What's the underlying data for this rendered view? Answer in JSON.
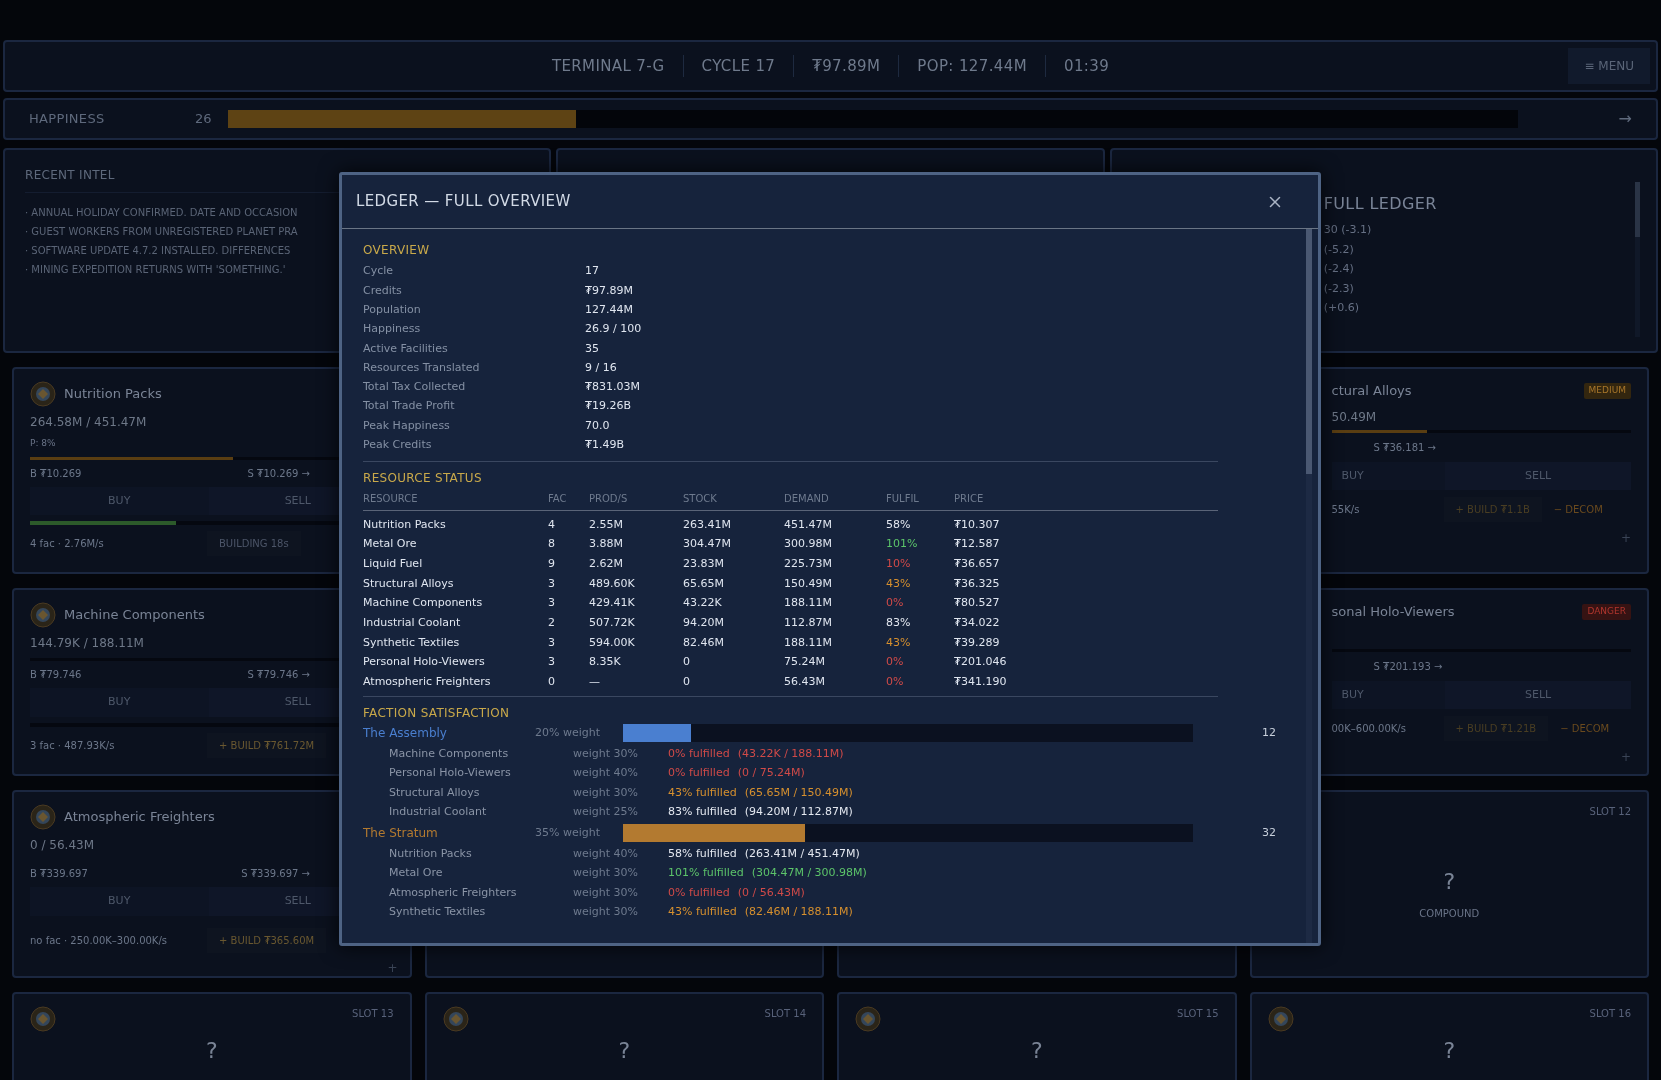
{
  "top_bar": {
    "items": [
      "TERMINAL 7-G",
      "CYCLE 17",
      "₮97.89M",
      "POP: 127.44M",
      "01:39"
    ],
    "menu_button": "≡ MENU"
  },
  "happiness": {
    "label": "HAPPINESS",
    "value": "26",
    "level": 0.27,
    "arrow": "→"
  },
  "intel": {
    "title": "RECENT INTEL",
    "items": [
      "· ANNUAL HOLIDAY CONFIRMED. DATE AND OCCASION",
      "· GUEST WORKERS FROM UNREGISTERED PLANET PRA",
      "· SOFTWARE UPDATE 4.7.2 INSTALLED. DIFFERENCES",
      "· MINING EXPEDITION RETURNS WITH 'SOMETHING.'"
    ]
  },
  "ledger_panel": {
    "button": "FULL LEDGER",
    "lines": [
      "30 (-3.1)",
      "(-5.2)",
      "(-2.4)",
      "(-2.3)",
      "(+0.6)"
    ]
  },
  "left_cards": [
    {
      "name": "Nutrition Packs",
      "stock": "264.58M / 451.47M",
      "note": "P: 8%",
      "stock_bar": {
        "level": 0.57
      },
      "buy_price": "B ₮10.269",
      "sell_price": "S ₮10.269 →",
      "buy": "BUY",
      "sell": "SELL",
      "production_bar": {
        "level": 0.41
      },
      "output": "4 fac · 2.76M/s",
      "action": {
        "label": "BUILDING 18s",
        "kind": "building"
      }
    },
    {
      "name": "Machine Components",
      "stock": "144.79K / 188.11M",
      "buy_price": "B ₮79.746",
      "sell_price": "S ₮79.746 →",
      "buy": "BUY",
      "sell": "SELL",
      "output": "3 fac · 487.93K/s",
      "action": {
        "label": "+ BUILD ₮761.72M",
        "kind": "build"
      }
    },
    {
      "name": "Atmospheric Freighters",
      "stock": "0 / 56.43M",
      "buy_price": "B ₮339.697",
      "sell_price": "S ₮339.697 →",
      "buy": "BUY",
      "sell": "SELL",
      "output": "no fac · 250.00K–300.00K/s",
      "action": {
        "label": "+ BUILD ₮365.60M",
        "kind": "build"
      },
      "plus": "+"
    }
  ],
  "right_cards": [
    {
      "name": "ctural Alloys",
      "risk": {
        "label": "MEDIUM",
        "kind": "medium"
      },
      "stock": "50.49M",
      "stock_bar": {
        "level": 0.32
      },
      "sell_price": "S ₮36.181 →",
      "buy": "BUY",
      "sell": "SELL",
      "output": "55K/s",
      "build": "+ BUILD ₮1.1B",
      "decom": "− DECOM",
      "plus": "+"
    },
    {
      "name": "sonal Holo-Viewers",
      "risk": {
        "label": "DANGER",
        "kind": "danger"
      },
      "sell_price": "S ₮201.193 →",
      "buy": "BUY",
      "sell": "SELL",
      "output": "00K–600.00K/s",
      "build": "+ BUILD ₮1.21B",
      "decom": "− DECOM",
      "plus": "+"
    }
  ],
  "slot_12": {
    "label": "SLOT 12",
    "mark": "?",
    "caption": "COMPOUND"
  },
  "bottom_slots": [
    {
      "label": "SLOT 13",
      "mark": "?"
    },
    {
      "label": "SLOT 14",
      "mark": "?"
    },
    {
      "label": "SLOT 15",
      "mark": "?"
    },
    {
      "label": "SLOT 16",
      "mark": "?"
    }
  ],
  "modal": {
    "title": "LEDGER — FULL OVERVIEW",
    "overview": {
      "title": "OVERVIEW",
      "rows": [
        {
          "label": "Cycle",
          "value": "17"
        },
        {
          "label": "Credits",
          "value": "₮97.89M"
        },
        {
          "label": "Population",
          "value": "127.44M"
        },
        {
          "label": "Happiness",
          "value": "26.9 / 100"
        },
        {
          "label": "Active Facilities",
          "value": "35"
        },
        {
          "label": "Resources Translated",
          "value": "9 / 16"
        },
        {
          "label": "Total Tax Collected",
          "value": "₮831.03M"
        },
        {
          "label": "Total Trade Profit",
          "value": "₮19.26B"
        },
        {
          "label": "Peak Happiness",
          "value": "70.0"
        },
        {
          "label": "Peak Credits",
          "value": "₮1.49B"
        }
      ]
    },
    "resources": {
      "title": "RESOURCE STATUS",
      "columns": [
        "RESOURCE",
        "FAC",
        "PROD/S",
        "STOCK",
        "DEMAND",
        "FULFIL",
        "PRICE"
      ],
      "rows": [
        {
          "cells": [
            "Nutrition Packs",
            "4",
            "2.55M",
            "263.41M",
            "451.47M",
            "58%",
            "₮10.307"
          ],
          "color": "#e4e8f0"
        },
        {
          "cells": [
            "Metal Ore",
            "8",
            "3.88M",
            "304.47M",
            "300.98M",
            "101%",
            "₮12.587"
          ],
          "color": "#5cc46a"
        },
        {
          "cells": [
            "Liquid Fuel",
            "9",
            "2.62M",
            "23.83M",
            "225.73M",
            "10%",
            "₮36.657"
          ],
          "color": "#d04a48"
        },
        {
          "cells": [
            "Structural Alloys",
            "3",
            "489.60K",
            "65.65M",
            "150.49M",
            "43%",
            "₮36.325"
          ],
          "color": "#d7902e"
        },
        {
          "cells": [
            "Machine Components",
            "3",
            "429.41K",
            "43.22K",
            "188.11M",
            "0%",
            "₮80.527"
          ],
          "color": "#d04a48"
        },
        {
          "cells": [
            "Industrial Coolant",
            "2",
            "507.72K",
            "94.20M",
            "112.87M",
            "83%",
            "₮34.022"
          ],
          "color": "#e4e8f0"
        },
        {
          "cells": [
            "Synthetic Textiles",
            "3",
            "594.00K",
            "82.46M",
            "188.11M",
            "43%",
            "₮39.289"
          ],
          "color": "#d7902e"
        },
        {
          "cells": [
            "Personal Holo-Viewers",
            "3",
            "8.35K",
            "0",
            "75.24M",
            "0%",
            "₮201.046"
          ],
          "color": "#d04a48"
        },
        {
          "cells": [
            "Atmospheric Freighters",
            "0",
            "—",
            "0",
            "56.43M",
            "0%",
            "₮341.190"
          ],
          "color": "#d04a48"
        }
      ]
    },
    "factions": {
      "title": "FACTION SATISFACTION",
      "items": [
        {
          "name": "The Assembly",
          "color": "#4a7fd0",
          "weight": "20% weight",
          "level": 0.12,
          "score": "12",
          "needs": [
            {
              "name": "Machine Components",
              "weight": "weight 30%",
              "fulfilled": "0% fulfilled",
              "detail": "(43.22K / 188.11M)",
              "color": "#d04a48"
            },
            {
              "name": "Personal Holo-Viewers",
              "weight": "weight 40%",
              "fulfilled": "0% fulfilled",
              "detail": "(0 / 75.24M)",
              "color": "#d04a48"
            },
            {
              "name": "Structural Alloys",
              "weight": "weight 30%",
              "fulfilled": "43% fulfilled",
              "detail": "(65.65M / 150.49M)",
              "color": "#d7902e"
            },
            {
              "name": "Industrial Coolant",
              "weight": "weight 25%",
              "fulfilled": "83% fulfilled",
              "detail": "(94.20M / 112.87M)",
              "color": "#e4e8f0"
            }
          ]
        },
        {
          "name": "The Stratum",
          "color": "#b37a30",
          "weight": "35% weight",
          "level": 0.32,
          "score": "32",
          "needs": [
            {
              "name": "Nutrition Packs",
              "weight": "weight 40%",
              "fulfilled": "58% fulfilled",
              "detail": "(263.41M / 451.47M)",
              "color": "#e4e8f0"
            },
            {
              "name": "Metal Ore",
              "weight": "weight 30%",
              "fulfilled": "101% fulfilled",
              "detail": "(304.47M / 300.98M)",
              "color": "#5cc46a"
            },
            {
              "name": "Atmospheric Freighters",
              "weight": "weight 30%",
              "fulfilled": "0% fulfilled",
              "detail": "(0 / 56.43M)",
              "color": "#d04a48"
            },
            {
              "name": "Synthetic Textiles",
              "weight": "weight 30%",
              "fulfilled": "43% fulfilled",
              "detail": "(82.46M / 188.11M)",
              "color": "#d7902e"
            }
          ]
        }
      ]
    }
  }
}
